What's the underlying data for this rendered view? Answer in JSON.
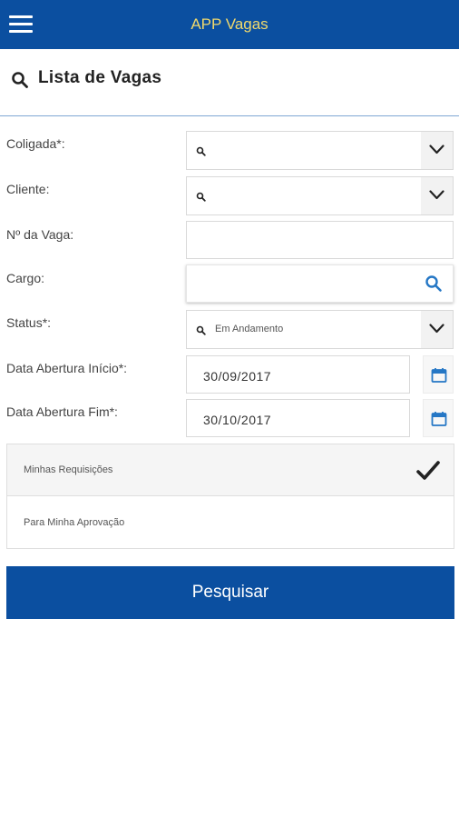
{
  "app_bar": {
    "title": "APP Vagas",
    "menu_icon": "hamburger-menu-icon"
  },
  "header": {
    "title": "Lista de Vagas",
    "icon": "search-icon"
  },
  "form": {
    "coligada": {
      "label": "Coligada*:",
      "value": ""
    },
    "cliente": {
      "label": "Cliente:",
      "value": ""
    },
    "numero_vaga": {
      "label": "Nº da Vaga:",
      "value": ""
    },
    "cargo": {
      "label": "Cargo:",
      "value": ""
    },
    "status": {
      "label": "Status*:",
      "value": "Em Andamento"
    },
    "data_inicio": {
      "label": "Data Abertura Início*:",
      "value": "30/09/2017"
    },
    "data_fim": {
      "label": "Data Abertura Fim*:",
      "value": "30/10/2017"
    }
  },
  "options": [
    {
      "label": "Minhas Requisições",
      "selected": true
    },
    {
      "label": "Para Minha Aprovação",
      "selected": false
    }
  ],
  "submit_label": "Pesquisar",
  "colors": {
    "primary": "#0b4fa0",
    "title_accent": "#f1d96c",
    "icon_blue": "#2577c5"
  }
}
